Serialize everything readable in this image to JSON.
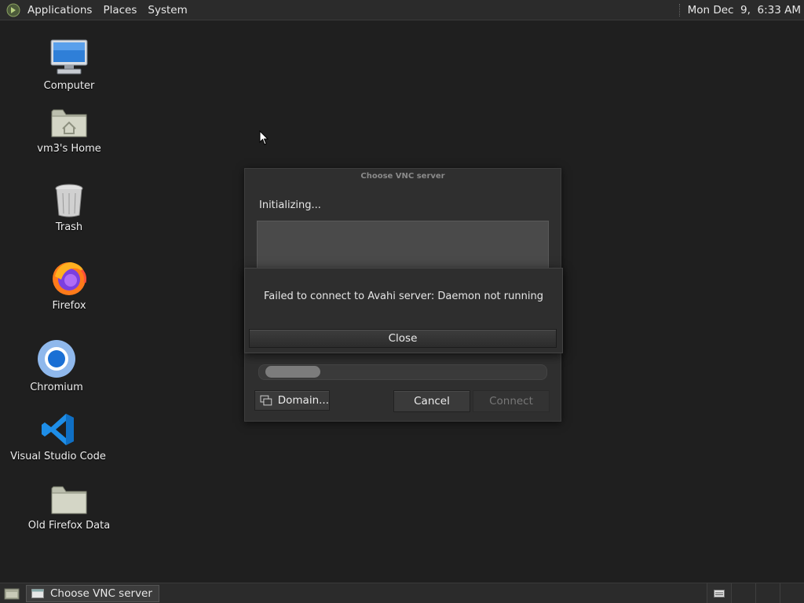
{
  "top_panel": {
    "menus": [
      "Applications",
      "Places",
      "System"
    ],
    "clock": "Mon Dec  9,  6:33 AM"
  },
  "desktop_icons": [
    {
      "label": "Computer",
      "icon": "computer-icon"
    },
    {
      "label": "vm3's Home",
      "icon": "home-folder-icon"
    },
    {
      "label": "Trash",
      "icon": "trash-icon"
    },
    {
      "label": "Firefox",
      "icon": "firefox-icon"
    },
    {
      "label": "Chromium",
      "icon": "chromium-icon"
    },
    {
      "label": "Visual Studio Code",
      "icon": "vscode-icon"
    },
    {
      "label": "Old Firefox Data",
      "icon": "folder-icon"
    }
  ],
  "vnc_dialog": {
    "title": "Choose VNC server",
    "status": "Initializing...",
    "buttons": {
      "domain": "Domain...",
      "cancel": "Cancel",
      "connect": "Connect"
    },
    "progress_fraction": 0.2
  },
  "error_dialog": {
    "message": "Failed to connect to Avahi server: Daemon not running",
    "close": "Close"
  },
  "taskbar": {
    "task": "Choose VNC server"
  },
  "colors": {
    "desktop_bg": "#1f1f1f",
    "panel_bg": "#2b2b2b",
    "dialog_bg": "#2f2f2f"
  }
}
